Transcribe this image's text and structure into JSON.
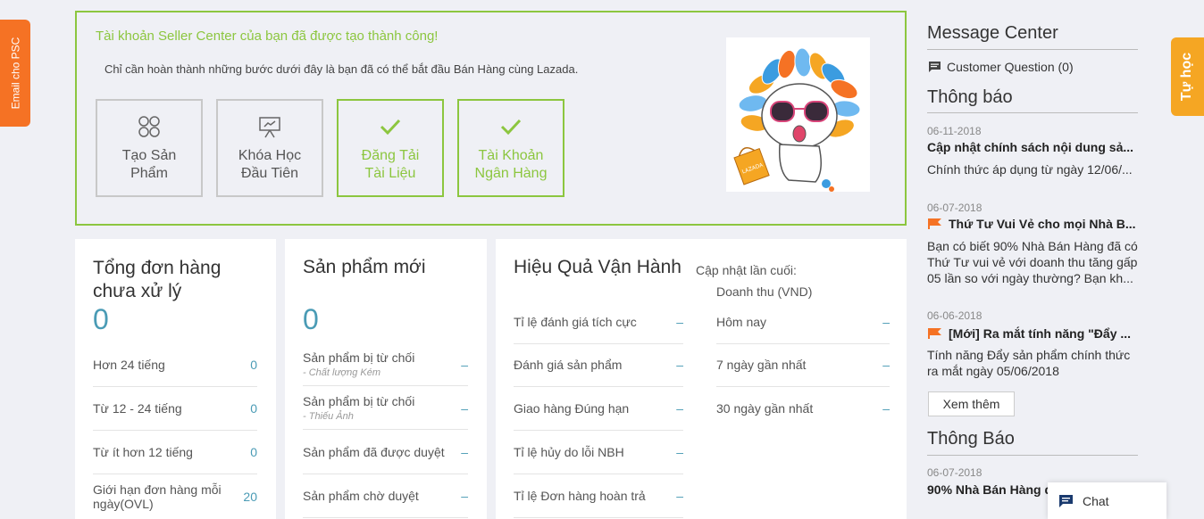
{
  "side_left": "Email cho PSC",
  "side_right": "Tự học",
  "onboard": {
    "title": "Tài khoản Seller Center của bạn đã được tạo thành công!",
    "subtitle": "Chỉ cần hoàn thành những bước dưới đây là bạn đã có thể bắt đầu Bán Hàng cùng Lazada.",
    "steps": [
      {
        "line1": "Tạo Sản",
        "line2": "Phẩm",
        "done": false,
        "icon": "product-icon"
      },
      {
        "line1": "Khóa Học",
        "line2": "Đầu Tiên",
        "done": false,
        "icon": "presentation-icon"
      },
      {
        "line1": "Đăng Tải",
        "line2": "Tài Liệu",
        "done": true,
        "icon": "check-icon"
      },
      {
        "line1": "Tài Khoản",
        "line2": "Ngân Hàng",
        "done": true,
        "icon": "check-icon"
      }
    ],
    "mascot_bag": "LAZADA"
  },
  "orders": {
    "title_line1": "Tổng đơn hàng",
    "title_line2": "chưa xử lý",
    "total": "0",
    "rows": [
      {
        "label": "Hơn 24 tiếng",
        "value": "0"
      },
      {
        "label": "Từ 12 - 24 tiếng",
        "value": "0"
      },
      {
        "label": "Từ ít hơn 12 tiếng",
        "value": "0"
      },
      {
        "label": "Giới hạn đơn hàng mỗi ngày(OVL)",
        "value": "20"
      }
    ]
  },
  "products": {
    "title": "Sản phẩm mới",
    "total": "0",
    "rows": [
      {
        "label": "Sản phẩm bị từ chối",
        "sub": "- Chất lượng Kém",
        "value": "–"
      },
      {
        "label": "Sản phẩm bị từ chối",
        "sub": "- Thiếu Ảnh",
        "value": "–"
      },
      {
        "label": "Sản phẩm đã được duyệt",
        "sub": "",
        "value": "–"
      },
      {
        "label": "Sản phẩm chờ duyệt",
        "sub": "",
        "value": "–"
      }
    ]
  },
  "performance": {
    "title": "Hiệu Quả Vận Hành",
    "updated": "Cập nhật lần cuối:",
    "revenue_label": "Doanh thu (VND)",
    "left_rows": [
      {
        "label": "Tỉ lệ đánh giá tích cực",
        "value": "–"
      },
      {
        "label": "Đánh giá sản phẩm",
        "value": "–"
      },
      {
        "label": "Giao hàng Đúng hạn",
        "value": "–"
      },
      {
        "label": "Tỉ lệ hủy do lỗi NBH",
        "value": "–"
      },
      {
        "label": "Tỉ lệ Đơn hàng hoàn trả",
        "value": "–"
      }
    ],
    "right_rows": [
      {
        "label": "Hôm nay",
        "value": "–"
      },
      {
        "label": "7 ngày gần nhất",
        "value": "–"
      },
      {
        "label": "30 ngày gần nhất",
        "value": "–"
      }
    ]
  },
  "right": {
    "message_center": "Message Center",
    "customer_question": "Customer Question (0)",
    "notices_title": "Thông báo",
    "notices": [
      {
        "date": "06-11-2018",
        "title": "Cập nhật chính sách nội dung sả...",
        "body": "Chính thức áp dụng từ ngày 12/06/...",
        "flag": false
      },
      {
        "date": "06-07-2018",
        "title": "Thứ Tư Vui Vẻ cho mọi Nhà B...",
        "body": "Bạn có biết 90% Nhà Bán Hàng đã có Thứ Tư vui vẻ với doanh thu tăng gấp 05 lần so với ngày thường? Bạn kh...",
        "flag": true
      },
      {
        "date": "06-06-2018",
        "title": "[Mới] Ra mắt tính năng \"Đẩy ...",
        "body": "Tính năng Đẩy sản phẩm chính thức ra mắt ngày 05/06/2018",
        "flag": true
      }
    ],
    "more_button": "Xem thêm",
    "announce_title": "Thông Báo",
    "announce": {
      "date": "06-07-2018",
      "title": "90% Nhà Bán Hàng đ"
    },
    "chat_label": "Chat"
  },
  "colors": {
    "accent_green": "#8cc63f",
    "accent_blue": "#4a9bb5",
    "orange": "#f57224",
    "orange_light": "#f5a623"
  }
}
